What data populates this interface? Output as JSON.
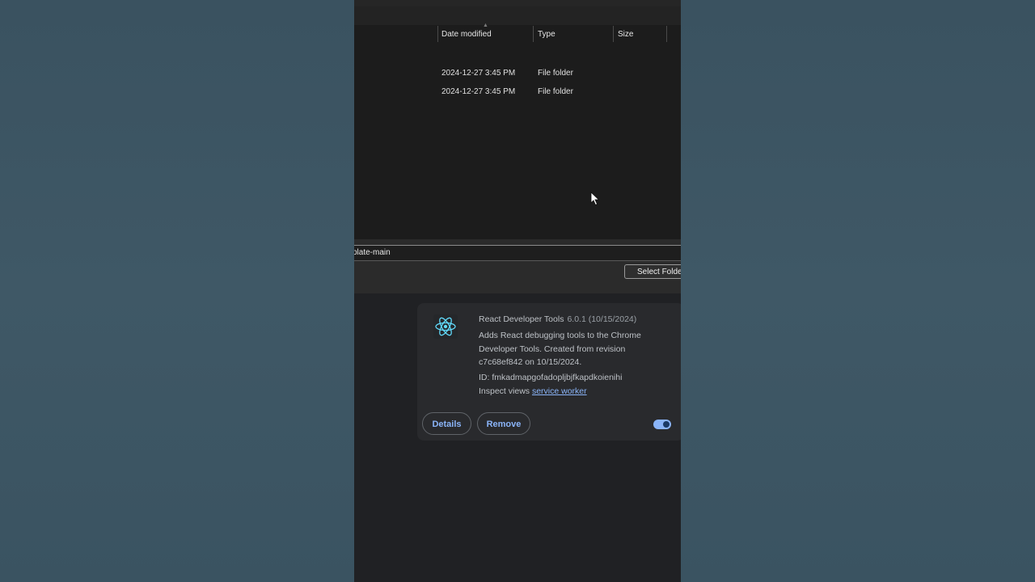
{
  "file_dialog": {
    "columns": [
      {
        "label": "Date modified"
      },
      {
        "label": "Type"
      },
      {
        "label": "Size"
      }
    ],
    "rows": [
      {
        "date": "2024-12-27 3:45 PM",
        "type": "File folder",
        "size": ""
      },
      {
        "date": "2024-12-27 3:45 PM",
        "type": "File folder",
        "size": ""
      }
    ],
    "folder_field_value": "plate-main",
    "select_button_label": "Select Folder"
  },
  "extension": {
    "name": "React Developer Tools",
    "version": "6.0.1 (10/15/2024)",
    "description": "Adds React debugging tools to the Chrome Developer Tools. Created from revision c7c68ef842 on 10/15/2024.",
    "id_label": "ID: fmkadmapgofadopljbjfkapdkoienihi",
    "inspect_label": "Inspect views",
    "inspect_link": "service worker",
    "details_label": "Details",
    "remove_label": "Remove",
    "enabled": true,
    "icon": "react-atom-icon",
    "accent_color": "#8ab4f8"
  }
}
